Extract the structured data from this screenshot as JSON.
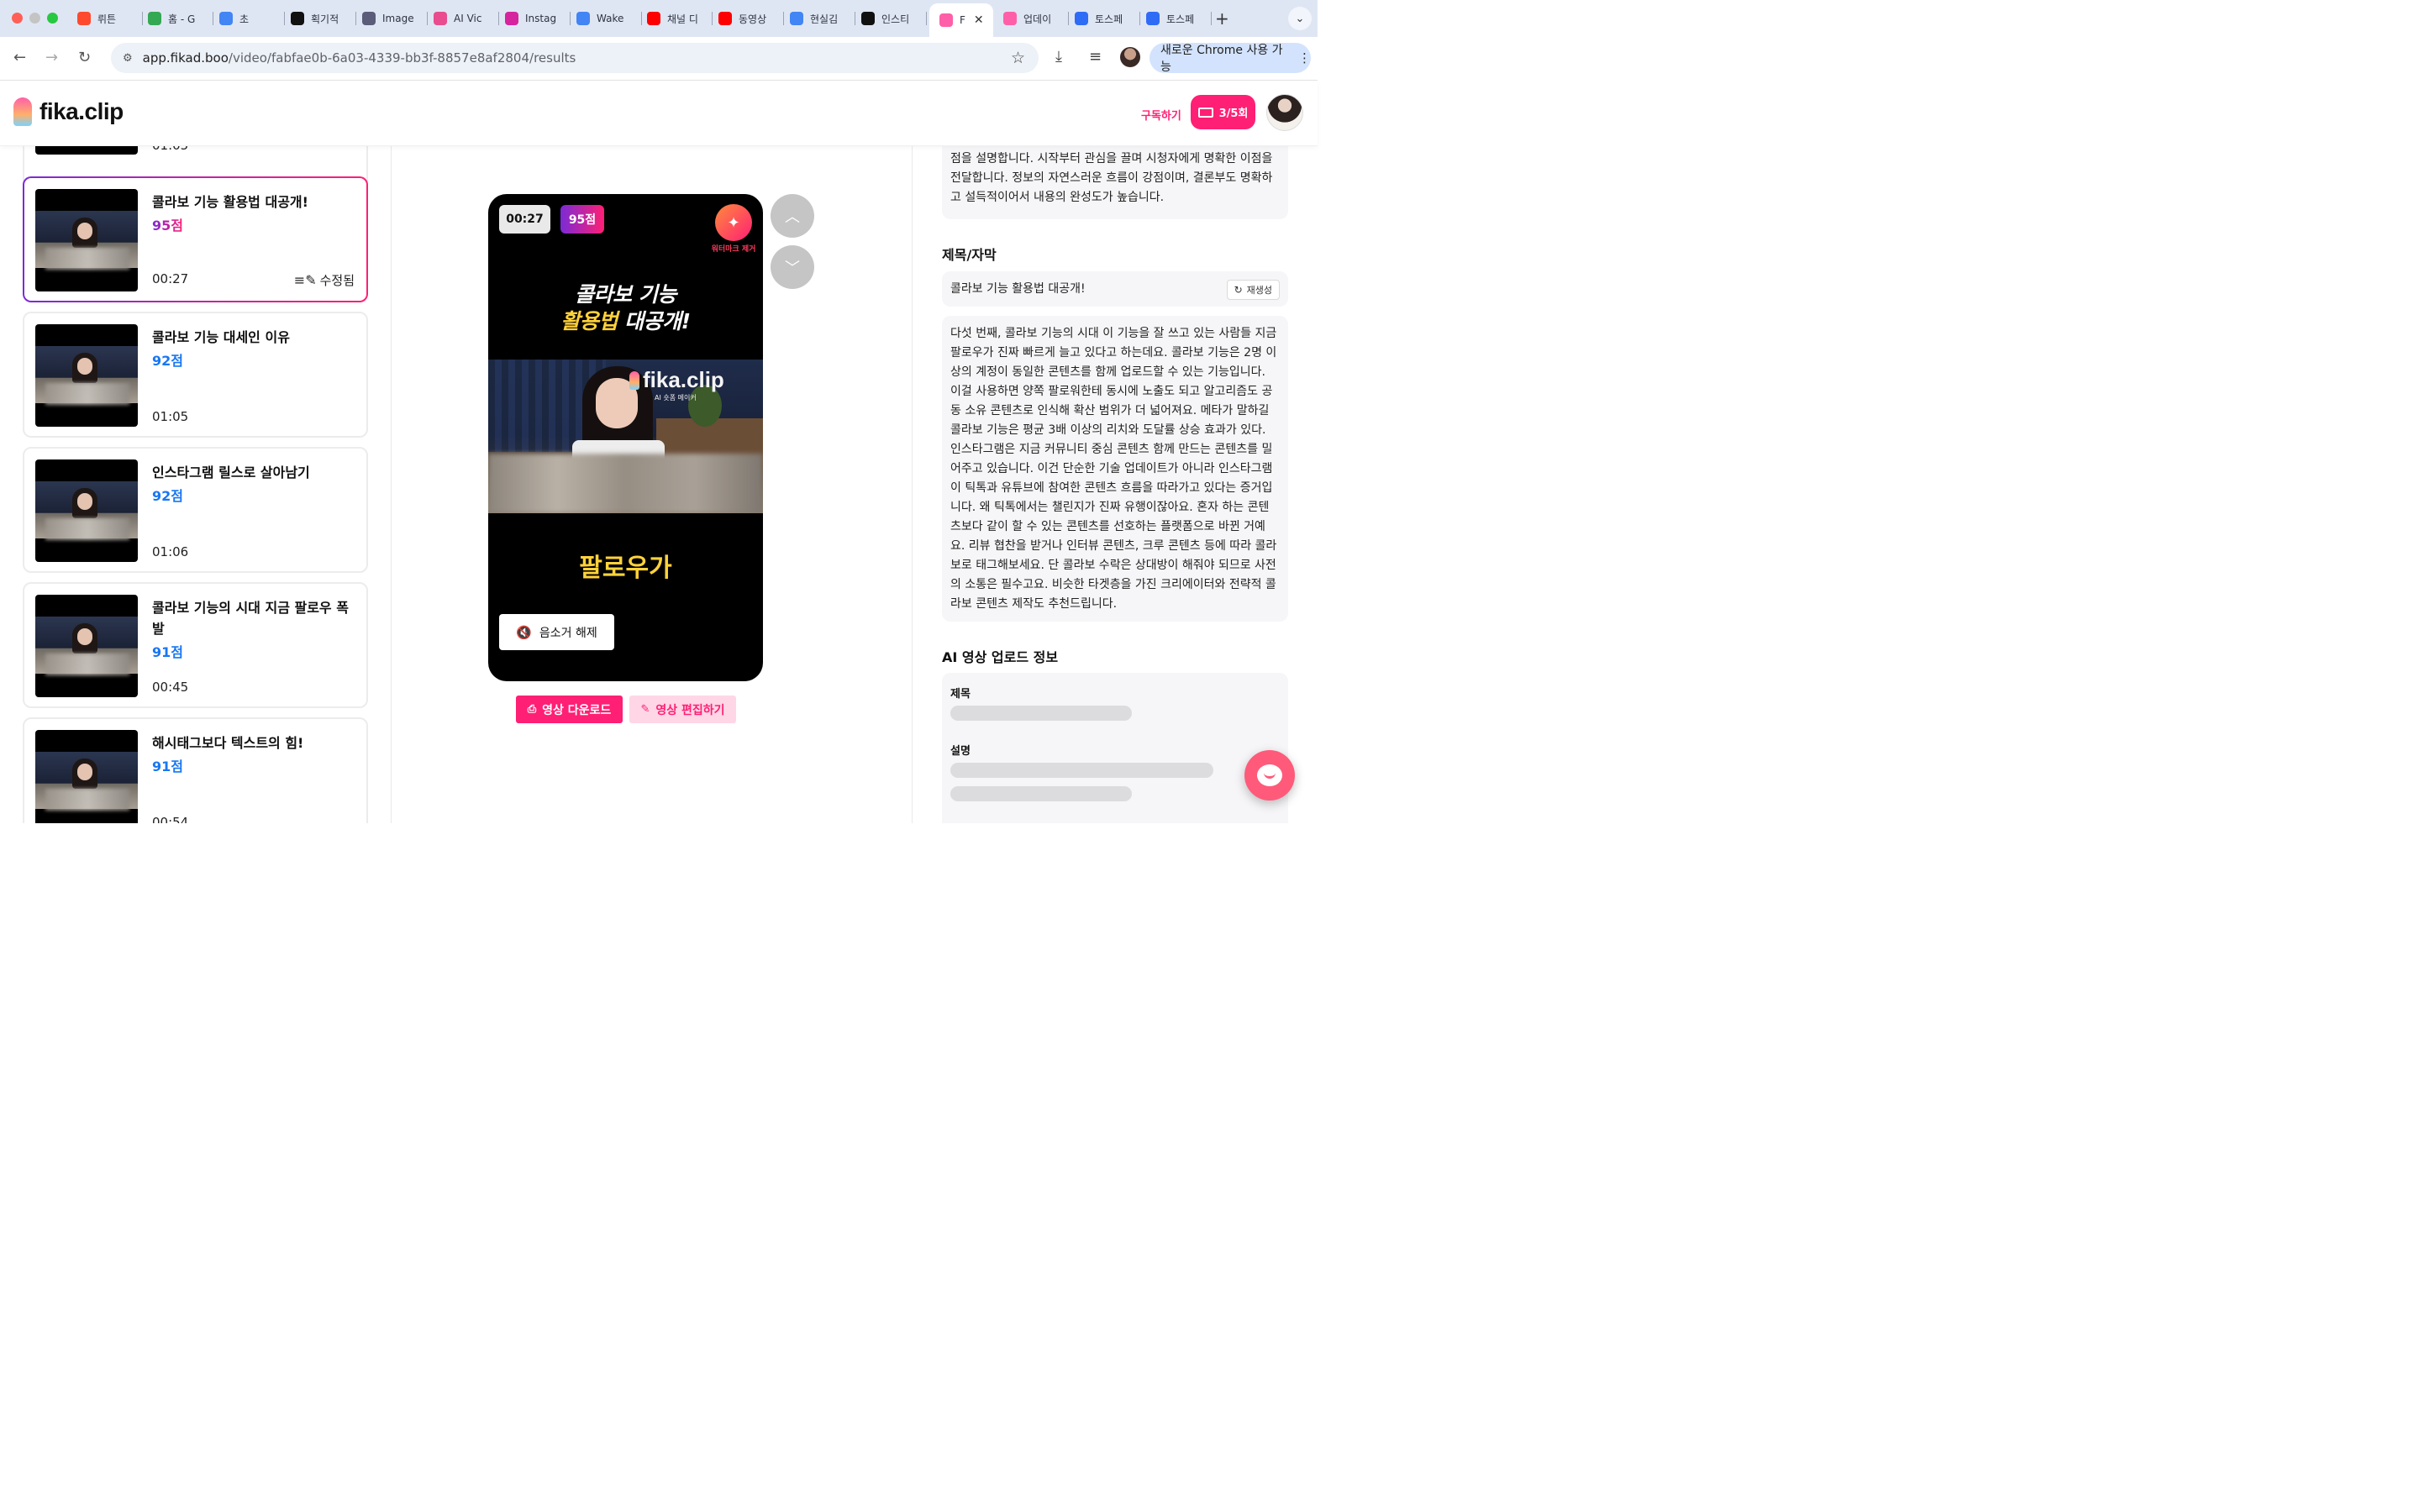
{
  "browser": {
    "tabs": [
      {
        "label": "뤼튼",
        "icon": "wrtn-icon",
        "color": "#ff4a2e"
      },
      {
        "label": "홈 - G",
        "icon": "google-drive-icon",
        "color": "#34a853"
      },
      {
        "label": "초",
        "icon": "google-docs-icon",
        "color": "#4285f4"
      },
      {
        "label": "획기적",
        "icon": "openai-icon",
        "color": "#111111"
      },
      {
        "label": "Image",
        "icon": "flask-icon",
        "color": "#5b5b7a"
      },
      {
        "label": "AI Vic",
        "icon": "ai-vic-icon",
        "color": "#e94c8f"
      },
      {
        "label": "Instag",
        "icon": "instagram-icon",
        "color": "#d6249f"
      },
      {
        "label": "Wake",
        "icon": "google-icon",
        "color": "#4285f4"
      },
      {
        "label": "채널 디",
        "icon": "youtube-icon",
        "color": "#ff0000"
      },
      {
        "label": "동영상",
        "icon": "youtube-icon",
        "color": "#ff0000"
      },
      {
        "label": "현실김",
        "icon": "google-icon",
        "color": "#4285f4"
      },
      {
        "label": "인스티",
        "icon": "threads-icon",
        "color": "#111111"
      },
      {
        "label": "F",
        "icon": "fika-icon",
        "color": "#ff5fa8"
      },
      {
        "label": "업데이",
        "icon": "fika-icon",
        "color": "#ff5fa8"
      },
      {
        "label": "토스페",
        "icon": "toss-icon",
        "color": "#2f6cf6"
      },
      {
        "label": "토스페",
        "icon": "toss-icon",
        "color": "#2f6cf6"
      }
    ],
    "active_tab_index": 12,
    "url_host": "app.fikad.boo",
    "url_path": "/video/fabfae0b-6a03-4339-bb3f-8857e8af2804/results",
    "update_label": "새로운 Chrome 사용 가능"
  },
  "header": {
    "logo": "fika.clip",
    "subscribe_label": "구독하기",
    "credits_label": "3/5회",
    "accent": "#ff1f74"
  },
  "list": {
    "partial_top_duration": "01:05",
    "items": [
      {
        "title": "콜라보 기능 활용법 대공개!",
        "score": "95점",
        "duration": "00:27",
        "edited_label": "수정됨",
        "selected": true
      },
      {
        "title": "콜라보 기능 대세인 이유",
        "score": "92점",
        "duration": "01:05"
      },
      {
        "title": "인스타그램 릴스로 살아남기",
        "score": "92점",
        "duration": "01:06"
      },
      {
        "title": "콜라보 기능의 시대 지금 팔로우 폭발",
        "score": "91점",
        "duration": "00:45"
      },
      {
        "title": "해시태그보다 텍스트의 힘!",
        "score": "91점",
        "duration": "00:54"
      }
    ]
  },
  "player": {
    "time": "00:27",
    "score": "95점",
    "watermark_label": "워터마크 제거",
    "headline_line1": "콜라보 기능",
    "headline_line2_highlight": "활용법",
    "headline_line2_rest": "대공개!",
    "video_logo": "fika.clip",
    "video_logo_sub": "AI 숏폼 메이커",
    "caption": "팔로우가",
    "unmute_label": "음소거 해제",
    "download_label": "영상 다운로드",
    "edit_label": "영상 편집하기"
  },
  "details": {
    "summary_tail_line1": "점을 설명합니다. 시작부터 관심을 끌며 시청자에게 명확한 이점을",
    "summary_tail_line2": "전달합니다. 정보의 자연스러운 흐름이 강점이며, 결론부도 명확하",
    "summary_tail_line3": "고 설득적이어서 내용의 완성도가 높습니다.",
    "title_section": "제목/자막",
    "title_value": "콜라보 기능 활용법 대공개!",
    "regen_label": "재생성",
    "script": "다섯 번째, 콜라보 기능의 시대 이 기능을 잘 쓰고 있는 사람들 지금 팔로우가 진짜 빠르게 늘고 있다고 하는데요. 콜라보 기능은 2명 이상의 계정이 동일한 콘텐츠를 함께 업로드할 수 있는 기능입니다. 이걸 사용하면 양쪽 팔로워한테 동시에 노출도 되고 알고리즘도 공동 소유 콘텐츠로 인식해 확산 범위가 더 넓어져요. 메타가 말하길 콜라보 기능은 평균 3배 이상의 리치와 도달률 상승 효과가 있다. 인스타그램은 지금 커뮤니티 중심 콘텐츠 함께 만드는 콘텐츠를 밀어주고 있습니다. 이건 단순한 기술 업데이트가 아니라 인스타그램이 틱톡과 유튜브에 참여한 콘텐츠 흐름을 따라가고 있다는 증거입니다. 왜 틱톡에서는 챌린지가 진짜 유행이잖아요. 혼자 하는 콘텐츠보다 같이 할 수 있는 콘텐츠를 선호하는 플랫폼으로 바뀐 거예요. 리뷰 협찬을 받거나 인터뷰 콘텐츠, 크루 콘텐츠 등에 따라 콜라보로 태그해보세요. 단 콜라보 수락은 상대방이 해줘야 되므로 사전의 소통은 필수고요. 비슷한 타겟층을 가진 크리에이터와 전략적 콜라보 콘텐츠 제작도 추천드립니다.",
    "upload_section": "AI 영상 업로드 정보",
    "upload_title_label": "제목",
    "upload_desc_label": "설명"
  }
}
